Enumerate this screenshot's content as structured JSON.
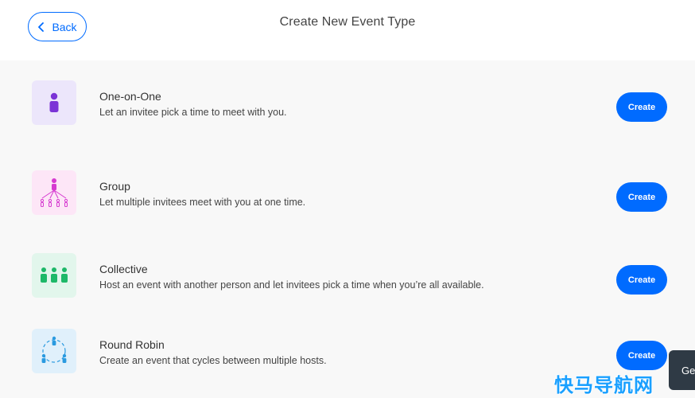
{
  "header": {
    "back_label": "Back",
    "title": "Create New Event Type"
  },
  "event_types": [
    {
      "name": "One-on-One",
      "description": "Let an invitee pick a time to meet with you.",
      "button_label": "Create",
      "icon": "single-person-icon",
      "tile_color": "#ece6fb",
      "icon_color": "#7b34d6"
    },
    {
      "name": "Group",
      "description": "Let multiple invitees meet with you at one time.",
      "button_label": "Create",
      "icon": "group-hierarchy-icon",
      "tile_color": "#fde6f7",
      "icon_color": "#d63ad0"
    },
    {
      "name": "Collective",
      "description": "Host an event with another person and let invitees pick a time when you’re all available.",
      "button_label": "Create",
      "icon": "three-people-icon",
      "tile_color": "#e2f6ec",
      "icon_color": "#1db868"
    },
    {
      "name": "Round Robin",
      "description": "Create an event that cycles between multiple hosts.",
      "button_label": "Create",
      "icon": "round-robin-icon",
      "tile_color": "#e0f0fb",
      "icon_color": "#2a9ae0"
    }
  ],
  "side_widget": {
    "label": "Ge"
  },
  "watermark": {
    "text": "快马导航网"
  },
  "colors": {
    "accent": "#006bff"
  }
}
